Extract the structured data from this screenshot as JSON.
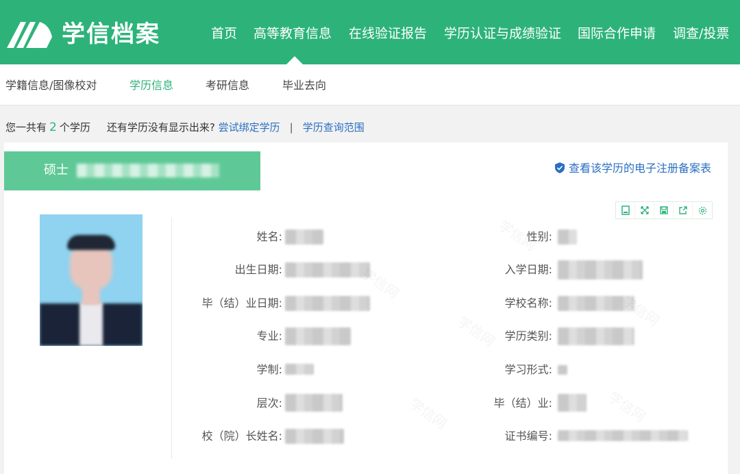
{
  "header": {
    "brand": "学信档案",
    "nav": [
      "首页",
      "高等教育信息",
      "在线验证报告",
      "学历认证与成绩验证",
      "国际合作申请",
      "调查/投票"
    ]
  },
  "subnav": {
    "items": [
      "学籍信息/图像校对",
      "学历信息",
      "考研信息",
      "毕业去向"
    ],
    "active_index": 1
  },
  "summary": {
    "prefix": "您一共有",
    "count": "2",
    "suffix": "个学历",
    "question": "还有学历没有显示出来?",
    "bind_link": "尝试绑定学历",
    "separator": "|",
    "scope_link": "学历查询范围"
  },
  "record": {
    "degree_label": "硕士",
    "registration_link": "查看该学历的电子注册备案表",
    "fields_left": [
      "姓名:",
      "出生日期:",
      "毕（结）业日期:",
      "专业:",
      "学制:",
      "层次:",
      "校（院）长姓名:"
    ],
    "fields_right": [
      "性别:",
      "入学日期:",
      "学校名称:",
      "学历类别:",
      "学习形式:",
      "毕（结）业:",
      "证书编号:"
    ]
  },
  "toolbar_icons": [
    "document-icon",
    "fullscreen-icon",
    "save-icon",
    "share-icon",
    "settings-icon"
  ],
  "colors": {
    "brand_green": "#2db37a",
    "tab_green": "#5ec996",
    "link_blue": "#2b6fc2"
  }
}
